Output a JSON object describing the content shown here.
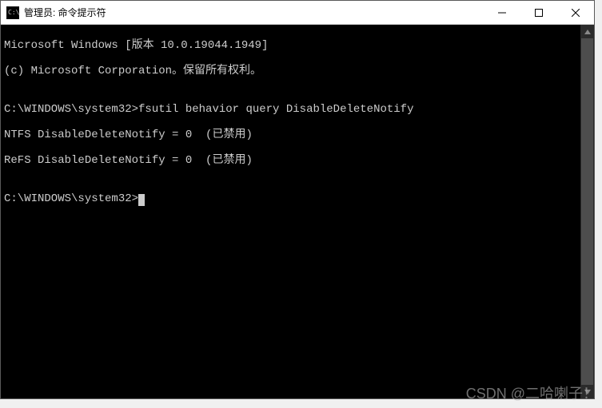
{
  "window": {
    "title": "管理员: 命令提示符"
  },
  "terminal": {
    "line1": "Microsoft Windows [版本 10.0.19044.1949]",
    "line2": "(c) Microsoft Corporation。保留所有权利。",
    "blank1": "",
    "prompt1": "C:\\WINDOWS\\system32>",
    "command1": "fsutil behavior query DisableDeleteNotify",
    "out1": "NTFS DisableDeleteNotify = 0  (已禁用)",
    "out2": "ReFS DisableDeleteNotify = 0  (已禁用)",
    "blank2": "",
    "prompt2": "C:\\WINDOWS\\system32>"
  },
  "watermark": "CSDN @二哈喇子！"
}
